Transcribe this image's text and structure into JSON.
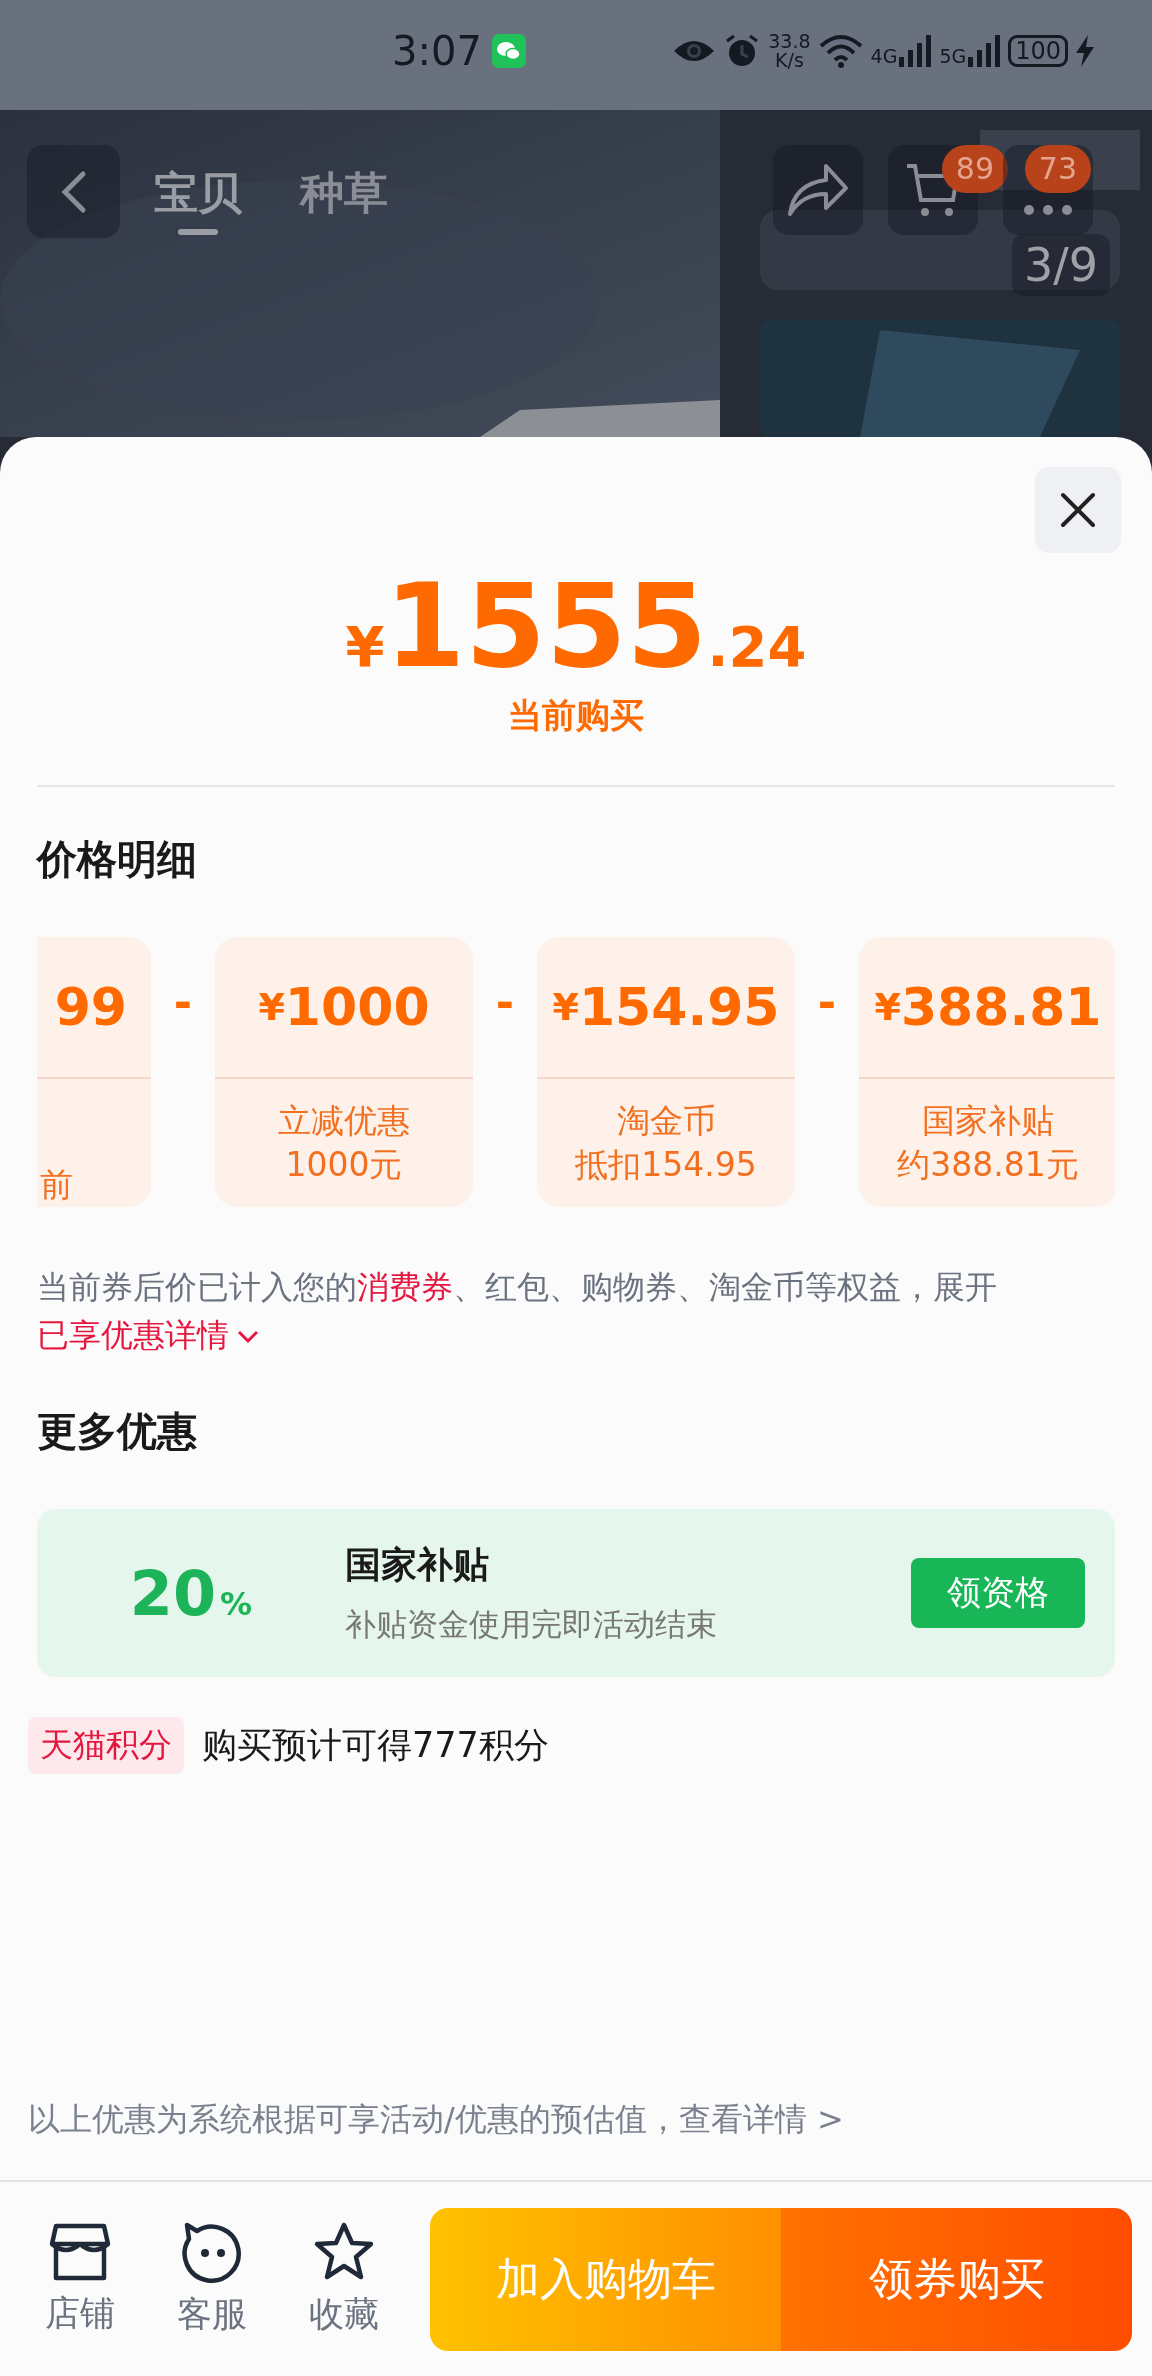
{
  "status_bar": {
    "time": "3:07",
    "net_speed": "33.8",
    "net_unit": "K/s",
    "signal_1": "4G",
    "signal_2": "5G",
    "battery": "100"
  },
  "header": {
    "tabs": [
      {
        "label": "宝贝",
        "selected": true
      },
      {
        "label": "种草",
        "selected": false
      }
    ],
    "cart_badge": "89",
    "more_badge": "73",
    "image_counter": "3/9"
  },
  "price": {
    "currency": "¥",
    "integer": "1555",
    "decimal": ".24",
    "caption": "当前购买"
  },
  "price_details": {
    "title": "价格明细",
    "cards": [
      {
        "amount": "99",
        "label_lines": [
          "前"
        ]
      },
      {
        "currency": "¥",
        "amount": "1000",
        "label_lines": [
          "立减优惠",
          "1000元"
        ],
        "operator": "-"
      },
      {
        "currency": "¥",
        "amount": "154.95",
        "label_lines": [
          "淘金币",
          "抵扣154.95"
        ],
        "operator": "-"
      },
      {
        "currency": "¥",
        "amount": "388.81",
        "label_lines": [
          "国家补贴",
          "约388.81元"
        ],
        "operator": "-"
      }
    ],
    "note": [
      {
        "text": "当前券后价已计入您的",
        "highlight": false
      },
      {
        "text": "消费券",
        "highlight": true
      },
      {
        "text": "、红包、购物券、淘金币等权益，展开",
        "highlight": false
      },
      {
        "text": "已享优惠详情",
        "highlight": true
      }
    ]
  },
  "more_offers": {
    "title": "更多优惠",
    "offer": {
      "percent": "20",
      "percent_sign": "%",
      "title": "国家补贴",
      "subtitle": "补贴资金使用完即活动结束",
      "button": "领资格"
    }
  },
  "points": {
    "tag": "天猫积分",
    "text": "购买预计可得777积分"
  },
  "disclaimer": "以上优惠为系统根据可享活动/优惠的预估值，查看详情 >",
  "bottom_bar": {
    "shortcuts": [
      {
        "kind": "store",
        "label": "店铺"
      },
      {
        "kind": "service",
        "label": "客服"
      },
      {
        "kind": "favorite",
        "label": "收藏"
      }
    ],
    "add_to_cart": "加入购物车",
    "buy": "领券购买"
  }
}
